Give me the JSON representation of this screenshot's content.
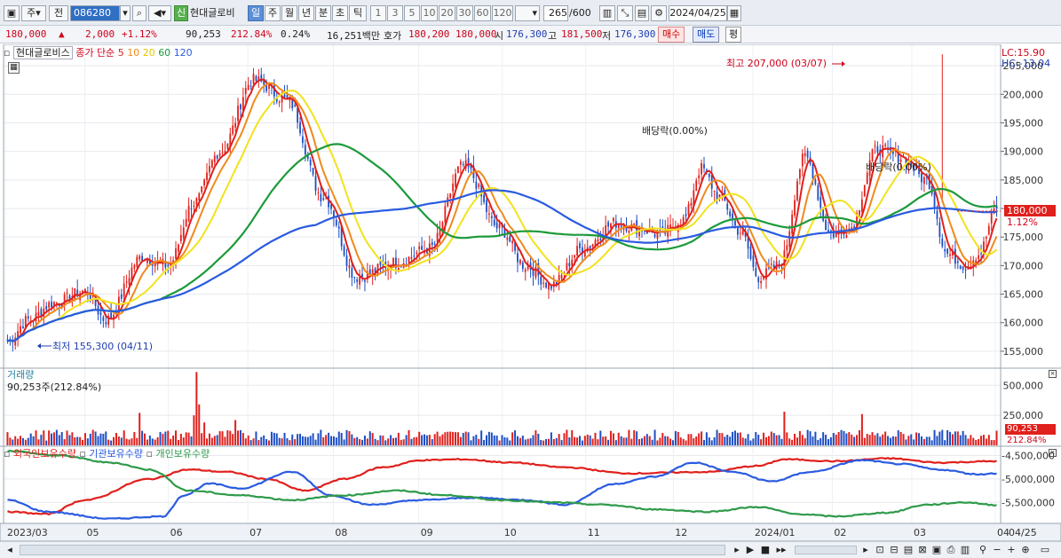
{
  "toolbar": {
    "period_type": "주",
    "prev_label": "전",
    "stock_code": "086280",
    "new_label": "신",
    "stock_name": "현대글로비",
    "periods": [
      "일",
      "주",
      "월",
      "년",
      "분",
      "초",
      "틱"
    ],
    "selected_period": "일",
    "intervals": [
      "1",
      "3",
      "5",
      "10",
      "20",
      "30",
      "60",
      "120"
    ],
    "count_value": "265",
    "count_total": "/600",
    "date_value": "2024/04/25"
  },
  "quote": {
    "price": "180,000",
    "change_arrow": "▲",
    "change": "2,000",
    "change_pct": "+1.12%",
    "volume": "90,253",
    "volume_pct": "212.84%",
    "turnover": "0.24%",
    "amount": "16,251백만",
    "ask_label": "호가",
    "ask_bid": "180,200  180,000",
    "open_label": "시",
    "open": "176,300",
    "high_label": "고",
    "high": "181,500",
    "low_label": "저",
    "low": "176,300",
    "buy_label": "매수",
    "sell_label": "매도",
    "avg_label": "평"
  },
  "colors": {
    "candle_up": "#e0201c",
    "candle_down": "#1d4fc4",
    "ma5": "#e0201c",
    "ma10": "#f08a1c",
    "ma20": "#f2e21c",
    "ma60": "#1c9a3a",
    "ma120": "#2a5be0",
    "foreign": "#e0201c",
    "institution": "#2a5be0",
    "individual": "#2e9a4a"
  },
  "chart_data": {
    "type": "candlestick",
    "title": "현대글로비스",
    "legend_price_label": "종가 단순",
    "ma_periods": [
      5,
      10,
      20,
      60,
      120
    ],
    "y_ticks": [
      "205,000",
      "200,000",
      "195,000",
      "190,000",
      "185,000",
      "180,000",
      "175,000",
      "170,000",
      "165,000",
      "160,000",
      "155,000"
    ],
    "ylim": [
      152500,
      207500
    ],
    "x_ticks": [
      "2023/03",
      "05",
      "06",
      "07",
      "08",
      "09",
      "10",
      "11",
      "12",
      "2024/01",
      "02",
      "03",
      "04",
      "04/25"
    ],
    "last_price_tag": "180,000",
    "last_change_tag": "1.12%",
    "lc_label": "LC:15.90",
    "hc_label": "HC:-13.04",
    "high_annotation": "최고 207,000 (03/07)",
    "low_annotation": "최저 155,300 (04/11)",
    "dividend_annotations": [
      "배당락(0.00%)",
      "배당락(0.00%)"
    ],
    "close_anchors": [
      [
        0,
        156800
      ],
      [
        8,
        160500
      ],
      [
        18,
        163500
      ],
      [
        30,
        165500
      ],
      [
        38,
        160500
      ],
      [
        52,
        171500
      ],
      [
        62,
        170000
      ],
      [
        72,
        181000
      ],
      [
        82,
        190000
      ],
      [
        95,
        202500
      ],
      [
        108,
        199000
      ],
      [
        122,
        182000
      ],
      [
        135,
        168000
      ],
      [
        150,
        170500
      ],
      [
        163,
        173000
      ],
      [
        176,
        187500
      ],
      [
        190,
        176500
      ],
      [
        200,
        170000
      ],
      [
        210,
        166500
      ],
      [
        222,
        173000
      ],
      [
        235,
        177500
      ],
      [
        244,
        176500
      ],
      [
        252,
        175500
      ],
      [
        261,
        178000
      ],
      [
        268,
        187000
      ],
      [
        275,
        182000
      ],
      [
        283,
        176000
      ],
      [
        290,
        168000
      ],
      [
        298,
        170000
      ],
      [
        308,
        189000
      ],
      [
        318,
        175500
      ],
      [
        325,
        176500
      ],
      [
        336,
        190500
      ],
      [
        345,
        189000
      ],
      [
        355,
        185000
      ],
      [
        363,
        172000
      ],
      [
        370,
        170000
      ],
      [
        375,
        172000
      ],
      [
        382,
        180000
      ]
    ],
    "volume_ticks": [
      "500,000",
      "250,000"
    ],
    "volume_ymax": 620000,
    "volume_label": "거래량",
    "volume_readout": "90,253주(212.84%)",
    "volume_tag": "90,253",
    "volume_pct_tag": "212.84%",
    "volume_spikes": [
      [
        72,
        250000
      ],
      [
        73,
        610000
      ],
      [
        74,
        340000
      ],
      [
        76,
        190000
      ],
      [
        51,
        270000
      ],
      [
        88,
        210000
      ],
      [
        300,
        280000
      ],
      [
        330,
        260000
      ]
    ],
    "holdings_legend": [
      "외국인보유수량",
      "기관보유수량",
      "개인보유수량"
    ],
    "holdings_ticks": [
      "-4,500,000",
      "-5,000,000",
      "-5,500,000"
    ],
    "holdings_ylim": [
      -5950000,
      -4300000
    ],
    "foreign_anchors": [
      [
        0,
        -5700000
      ],
      [
        15,
        -5750000
      ],
      [
        30,
        -5450000
      ],
      [
        55,
        -5000000
      ],
      [
        70,
        -4800000
      ],
      [
        85,
        -4850000
      ],
      [
        100,
        -5000000
      ],
      [
        115,
        -5250000
      ],
      [
        130,
        -5000000
      ],
      [
        145,
        -4750000
      ],
      [
        160,
        -4600000
      ],
      [
        175,
        -4580000
      ],
      [
        195,
        -4650000
      ],
      [
        215,
        -4750000
      ],
      [
        240,
        -4880000
      ],
      [
        270,
        -4850000
      ],
      [
        290,
        -4720000
      ],
      [
        300,
        -4580000
      ],
      [
        320,
        -4620000
      ],
      [
        340,
        -4560000
      ],
      [
        360,
        -4650000
      ],
      [
        382,
        -4620000
      ]
    ],
    "institution_anchors": [
      [
        0,
        -5450000
      ],
      [
        15,
        -5700000
      ],
      [
        40,
        -5850000
      ],
      [
        60,
        -5800000
      ],
      [
        68,
        -5350000
      ],
      [
        78,
        -5100000
      ],
      [
        90,
        -5200000
      ],
      [
        110,
        -4850000
      ],
      [
        125,
        -5350000
      ],
      [
        140,
        -5550000
      ],
      [
        160,
        -5450000
      ],
      [
        180,
        -5400000
      ],
      [
        200,
        -5450000
      ],
      [
        215,
        -5550000
      ],
      [
        235,
        -5100000
      ],
      [
        250,
        -4950000
      ],
      [
        265,
        -4650000
      ],
      [
        280,
        -4850000
      ],
      [
        295,
        -5050000
      ],
      [
        310,
        -4850000
      ],
      [
        330,
        -4600000
      ],
      [
        345,
        -4680000
      ],
      [
        360,
        -4800000
      ],
      [
        375,
        -4900000
      ],
      [
        382,
        -4880000
      ]
    ],
    "individual_anchors": [
      [
        0,
        -4400000
      ],
      [
        20,
        -4500000
      ],
      [
        40,
        -4650000
      ],
      [
        55,
        -4800000
      ],
      [
        70,
        -5250000
      ],
      [
        90,
        -5350000
      ],
      [
        110,
        -5450000
      ],
      [
        130,
        -5350000
      ],
      [
        150,
        -5250000
      ],
      [
        170,
        -5350000
      ],
      [
        190,
        -5450000
      ],
      [
        210,
        -5500000
      ],
      [
        230,
        -5550000
      ],
      [
        250,
        -5650000
      ],
      [
        270,
        -5700000
      ],
      [
        290,
        -5600000
      ],
      [
        305,
        -5750000
      ],
      [
        320,
        -5800000
      ],
      [
        340,
        -5720000
      ],
      [
        355,
        -5550000
      ],
      [
        370,
        -5500000
      ],
      [
        382,
        -5560000
      ]
    ]
  },
  "bottom": {
    "zoom_out": "−",
    "zoom_in": "+"
  }
}
